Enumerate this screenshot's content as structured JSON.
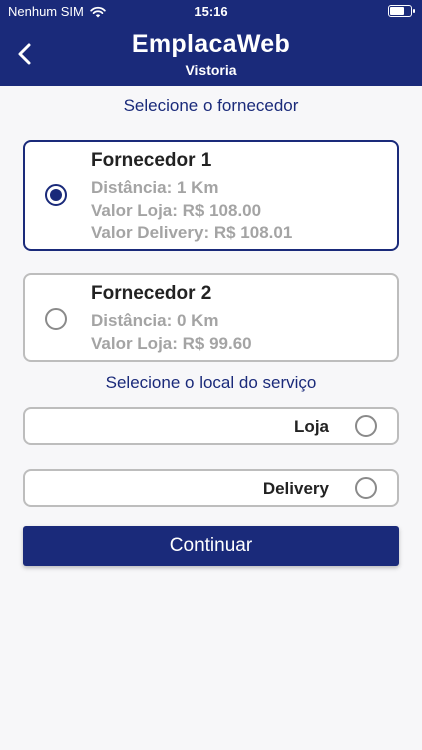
{
  "status_bar": {
    "carrier": "Nenhum SIM",
    "time": "15:16",
    "battery_level": 0.75
  },
  "header": {
    "title": "EmplacaWeb",
    "subtitle": "Vistoria",
    "back_icon": "chevron-left-icon"
  },
  "supplier_section": {
    "label": "Selecione o fornecedor",
    "suppliers": [
      {
        "name": "Fornecedor 1",
        "distance": "Distância: 1 Km",
        "store_price": "Valor Loja: R$ 108.00",
        "delivery_price": "Valor Delivery: R$ 108.01",
        "selected": true
      },
      {
        "name": "Fornecedor 2",
        "distance": "Distância: 0 Km",
        "store_price": "Valor Loja: R$ 99.60",
        "selected": false
      }
    ]
  },
  "service_section": {
    "label": "Selecione o local do serviço",
    "options": [
      {
        "label": "Loja",
        "selected": false
      },
      {
        "label": "Delivery",
        "selected": false
      }
    ]
  },
  "continue_label": "Continuar",
  "colors": {
    "primary": "#1a2a7a",
    "background": "#f7f7f9",
    "muted_text": "#a4a4a4",
    "border": "#bdbdbd"
  }
}
